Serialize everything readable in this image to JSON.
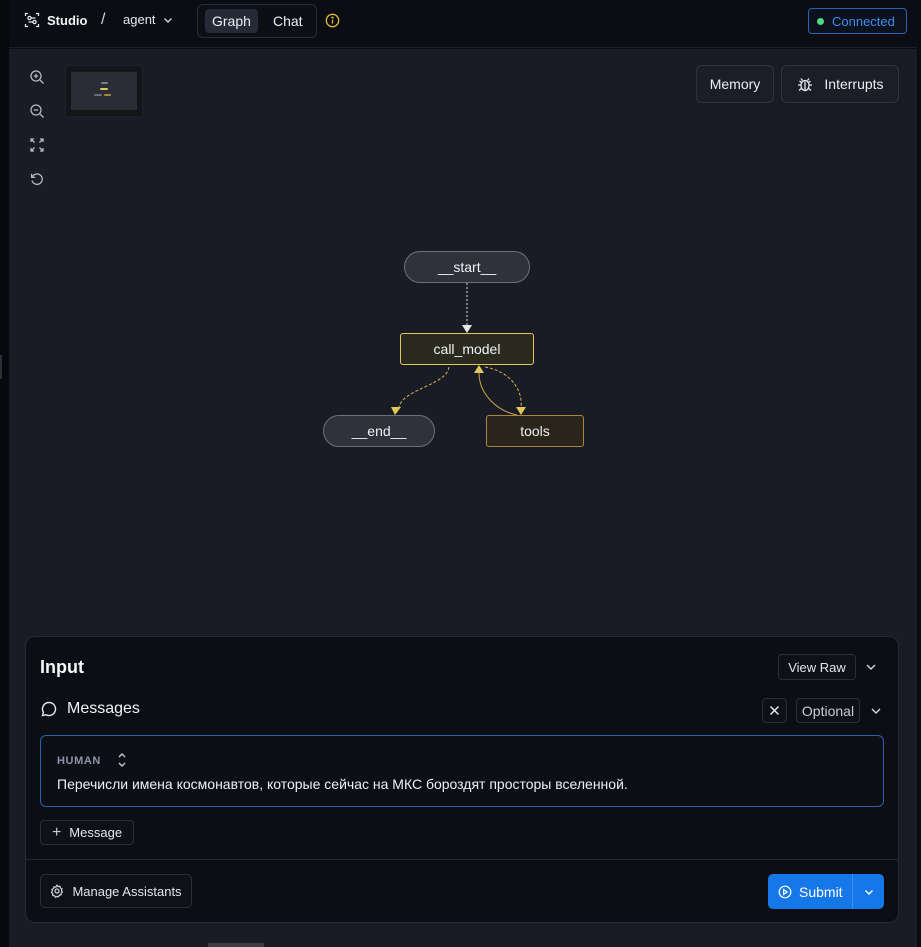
{
  "topbar": {
    "brand": "Studio",
    "separator": "/",
    "agent": "agent",
    "modes": {
      "graph": "Graph",
      "chat": "Chat"
    },
    "status": "Connected"
  },
  "canvas": {
    "memory_label": "Memory",
    "interrupts_label": "Interrupts",
    "nodes": {
      "start": "__start__",
      "call_model": "call_model",
      "end": "__end__",
      "tools": "tools"
    }
  },
  "input_panel": {
    "title": "Input",
    "view_raw": "View Raw",
    "messages_label": "Messages",
    "optional": "Optional",
    "message": {
      "role": "HUMAN",
      "text": "Перечисли имена космонавтов, которые сейчас на МКС бороздят просторы вселенной."
    },
    "add_message": "Message",
    "manage_assistants": "Manage Assistants",
    "submit": "Submit"
  },
  "colors": {
    "accent": "#1678e8",
    "connected_dot": "#4ade80",
    "node_highlight": "#e2c85a"
  }
}
